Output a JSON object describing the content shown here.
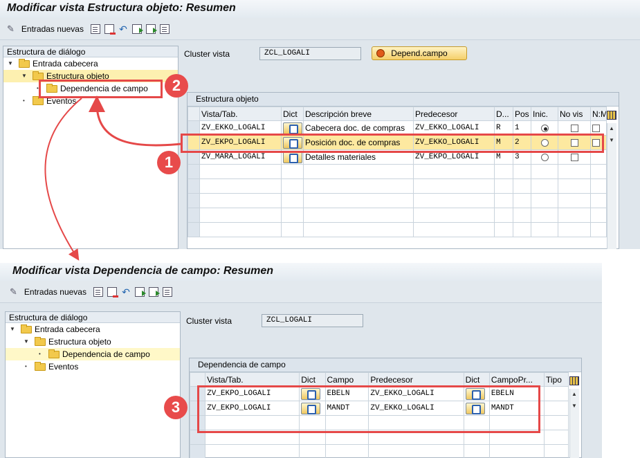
{
  "top": {
    "title": "Modificar vista Estructura objeto: Resumen",
    "toolbar": {
      "new_entries": "Entradas nuevas"
    },
    "tree": {
      "header": "Estructura de diálogo",
      "items": [
        "Entrada cabecera",
        "Estructura objeto",
        "Dependencia de campo",
        "Eventos"
      ]
    },
    "cluster_label": "Cluster vista",
    "cluster_value": "ZCL_LOGALI",
    "depend_button": "Depend.campo",
    "grid_title": "Estructura objeto",
    "columns": [
      "Vista/Tab.",
      "Dict",
      "Descripción breve",
      "Predecesor",
      "D...",
      "Pos",
      "Inic.",
      "No vis",
      "N:M"
    ],
    "rows": [
      {
        "vista": "ZV_EKKO_LOGALI",
        "desc": "Cabecera doc. de compras",
        "pred": "ZV_EKKO_LOGALI",
        "d": "R",
        "pos": "1",
        "inic": true,
        "novis": false
      },
      {
        "vista": "ZV_EKPO_LOGALI",
        "desc": "Posición doc. de compras",
        "pred": "ZV_EKKO_LOGALI",
        "d": "M",
        "pos": "2",
        "inic": false,
        "novis": false
      },
      {
        "vista": "ZV_MARA_LOGALI",
        "desc": "Detalles materiales",
        "pred": "ZV_EKPO_LOGALI",
        "d": "M",
        "pos": "3",
        "inic": false,
        "novis": false
      }
    ]
  },
  "bottom": {
    "title": "Modificar vista Dependencia de campo: Resumen",
    "toolbar": {
      "new_entries": "Entradas nuevas"
    },
    "tree": {
      "header": "Estructura de diálogo",
      "items": [
        "Entrada cabecera",
        "Estructura objeto",
        "Dependencia de campo",
        "Eventos"
      ]
    },
    "cluster_label": "Cluster vista",
    "cluster_value": "ZCL_LOGALI",
    "grid_title": "Dependencia de campo",
    "columns": [
      "Vista/Tab.",
      "Dict",
      "Campo",
      "Predecesor",
      "Dict",
      "CampoPr...",
      "Tipo"
    ],
    "rows": [
      {
        "vista": "ZV_EKPO_LOGALI",
        "campo": "EBELN",
        "pred": "ZV_EKKO_LOGALI",
        "campopr": "EBELN",
        "tipo": ""
      },
      {
        "vista": "ZV_EKPO_LOGALI",
        "campo": "MANDT",
        "pred": "ZV_EKKO_LOGALI",
        "campopr": "MANDT",
        "tipo": ""
      }
    ]
  },
  "callouts": [
    "1",
    "2",
    "3"
  ],
  "colors": {
    "callout": "#e84b4b",
    "highlight": "#fde9a0",
    "button": "#f5cf6a"
  },
  "icons": [
    "new-entries-icon",
    "copy-icon",
    "delete-icon",
    "undo-icon",
    "select-all-icon",
    "select-block-icon",
    "deselect-icon",
    "dict-icon",
    "column-settings-icon",
    "folder-icon"
  ]
}
